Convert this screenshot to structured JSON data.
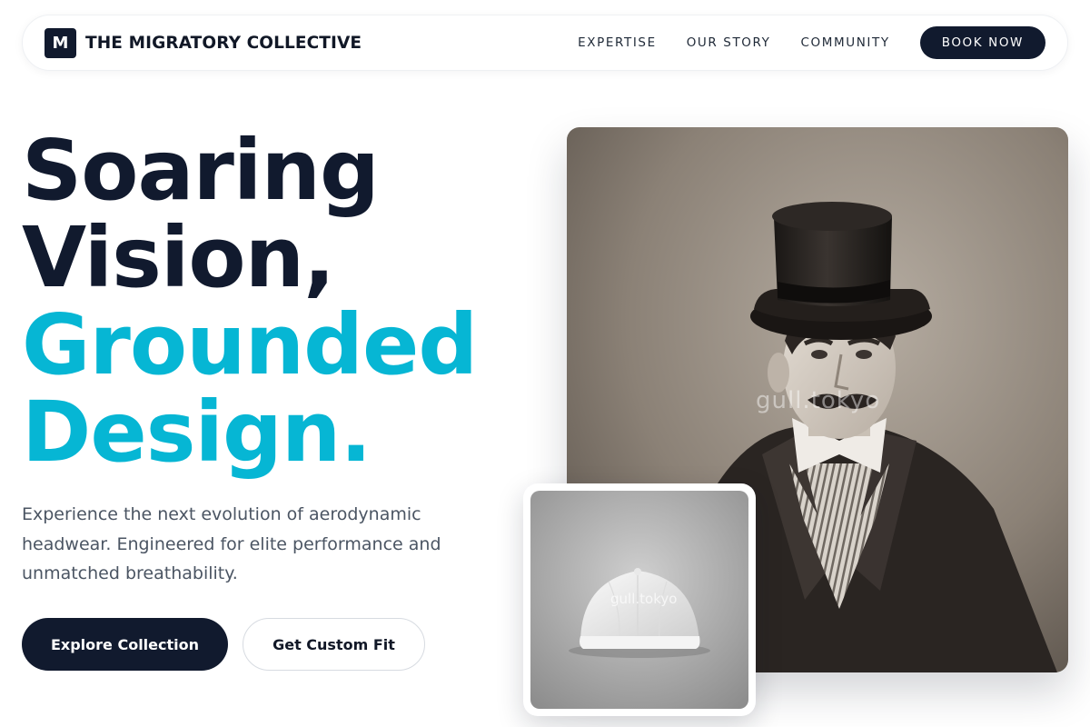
{
  "header": {
    "logo_letter": "M",
    "brand_name": "THE MIGRATORY COLLECTIVE",
    "nav": [
      "EXPERTISE",
      "OUR STORY",
      "COMMUNITY"
    ],
    "cta": "BOOK NOW"
  },
  "hero": {
    "headline_dark": [
      "Soaring",
      "Vision,"
    ],
    "headline_accent": [
      "Grounded",
      "Design."
    ],
    "subtext": "Experience the next evolution of aerodynamic headwear. Engineered for elite performance and unmatched breathability.",
    "primary_cta": "Explore Collection",
    "secondary_cta": "Get Custom Fit",
    "image_watermark": "gull.tokyo",
    "cap_watermark": "gull.tokyo"
  },
  "colors": {
    "navy": "#111a2e",
    "accent": "#06b6d4",
    "body_text": "#4b5563"
  }
}
